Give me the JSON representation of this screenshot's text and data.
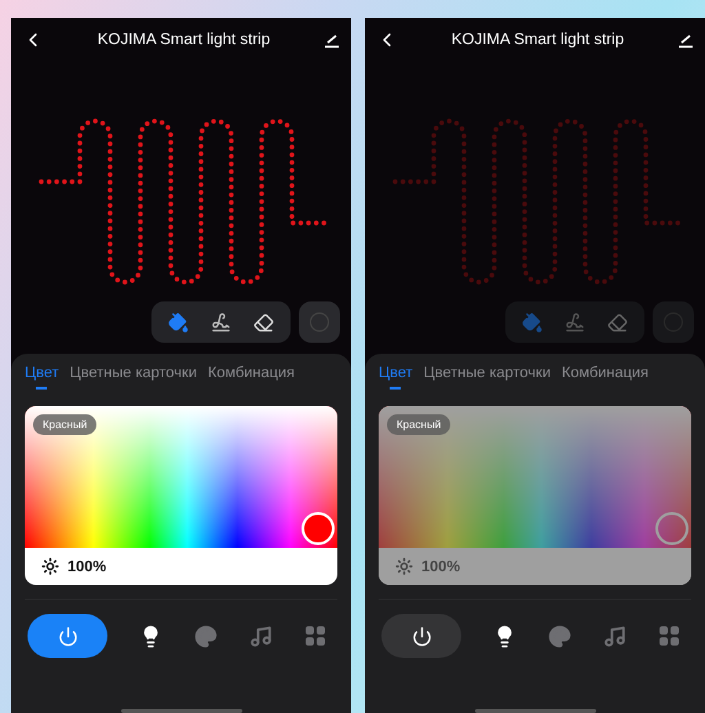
{
  "screens": [
    {
      "title": "KOJIMA  Smart light strip",
      "power_on": true,
      "tabs": [
        {
          "label": "Цвет",
          "selected": true
        },
        {
          "label": "Цветные карточки",
          "selected": false
        },
        {
          "label": "Комбинация",
          "selected": false
        }
      ],
      "color_name": "Красный",
      "brightness": "100%",
      "nav": [
        {
          "kind": "bulb",
          "selected": true
        },
        {
          "kind": "palette",
          "selected": false
        },
        {
          "kind": "music",
          "selected": false
        },
        {
          "kind": "grid",
          "selected": false
        }
      ]
    },
    {
      "title": "KOJIMA  Smart light strip",
      "power_on": false,
      "tabs": [
        {
          "label": "Цвет",
          "selected": true
        },
        {
          "label": "Цветные карточки",
          "selected": false
        },
        {
          "label": "Комбинация",
          "selected": false
        }
      ],
      "color_name": "Красный",
      "brightness": "100%",
      "nav": [
        {
          "kind": "bulb",
          "selected": true
        },
        {
          "kind": "palette",
          "selected": false
        },
        {
          "kind": "music",
          "selected": false
        },
        {
          "kind": "grid",
          "selected": false
        }
      ]
    }
  ]
}
